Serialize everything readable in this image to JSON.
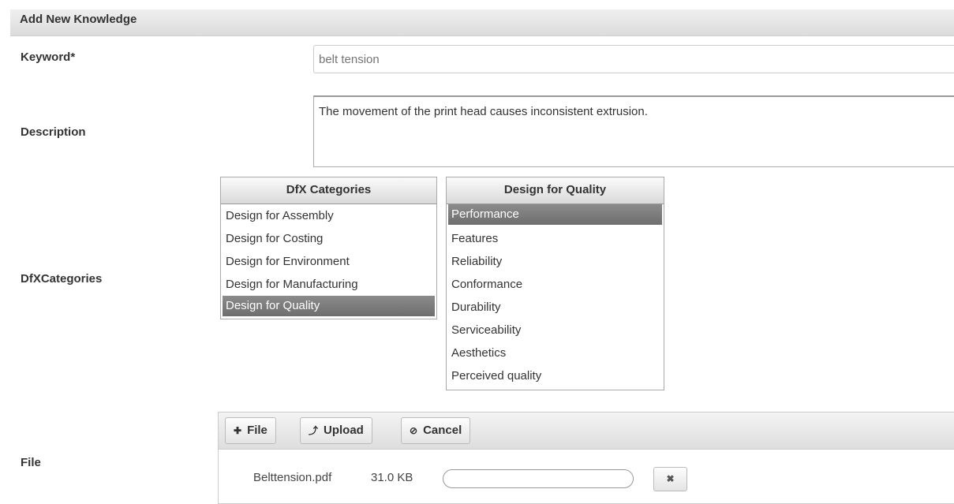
{
  "header": {
    "title": "Add New Knowledge"
  },
  "keyword": {
    "label": "Keyword*",
    "placeholder": "belt tension",
    "value": ""
  },
  "description": {
    "label": "Description",
    "value": "The movement of the print head causes inconsistent extrusion."
  },
  "dfx": {
    "label": "DfXCategories",
    "categories": {
      "title": "DfX Categories",
      "items": [
        "Design for Assembly",
        "Design for Costing",
        "Design for Environment",
        "Design for Manufacturing",
        "Design for Quality"
      ],
      "selected": "Design for Quality"
    },
    "subcategories": {
      "title": "Design for Quality",
      "items": [
        "Performance",
        "Features",
        "Reliability",
        "Conformance",
        "Durability",
        "Serviceability",
        "Aesthetics",
        "Perceived quality"
      ],
      "selected": "Performance"
    }
  },
  "file": {
    "label": "File",
    "buttons": {
      "add": {
        "label": "File",
        "icon": "plus-icon"
      },
      "upload": {
        "label": "Upload",
        "icon": "upload-arrow-icon"
      },
      "cancel": {
        "label": "Cancel",
        "icon": "cancel-circle-icon"
      }
    },
    "entry": {
      "name": "Belttension.pdf",
      "size": "31.0 KB",
      "progress": 0,
      "remove_icon": "close-x-icon"
    }
  }
}
